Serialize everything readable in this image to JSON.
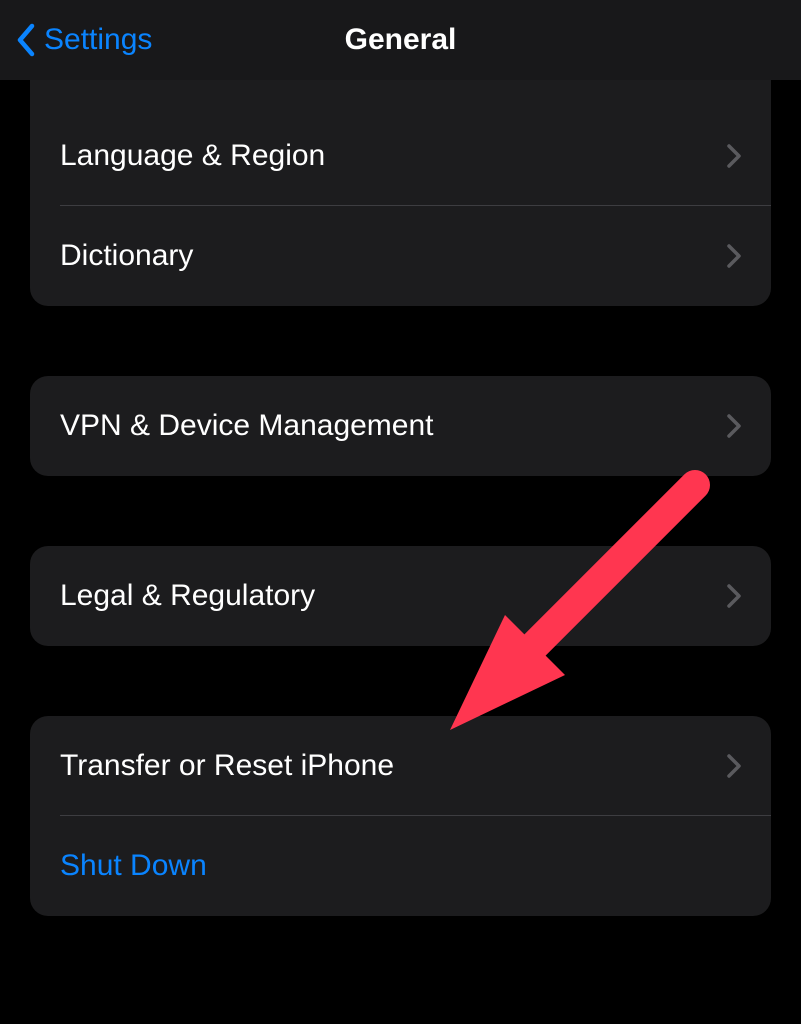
{
  "nav": {
    "back_label": "Settings",
    "title": "General"
  },
  "groups": [
    {
      "id": "lang-dict",
      "top_continued": true,
      "rows": [
        {
          "id": "language-region",
          "label": "Language & Region",
          "chevron": true,
          "blue": false
        },
        {
          "id": "dictionary",
          "label": "Dictionary",
          "chevron": true,
          "blue": false
        }
      ]
    },
    {
      "id": "vpn",
      "top_continued": false,
      "rows": [
        {
          "id": "vpn-device-management",
          "label": "VPN & Device Management",
          "chevron": true,
          "blue": false
        }
      ]
    },
    {
      "id": "legal",
      "top_continued": false,
      "rows": [
        {
          "id": "legal-regulatory",
          "label": "Legal & Regulatory",
          "chevron": true,
          "blue": false
        }
      ]
    },
    {
      "id": "reset-shutdown",
      "top_continued": false,
      "rows": [
        {
          "id": "transfer-reset",
          "label": "Transfer or Reset iPhone",
          "chevron": true,
          "blue": false
        },
        {
          "id": "shut-down",
          "label": "Shut Down",
          "chevron": false,
          "blue": true
        }
      ]
    }
  ],
  "annotation": {
    "arrow_color": "#ff3650"
  }
}
